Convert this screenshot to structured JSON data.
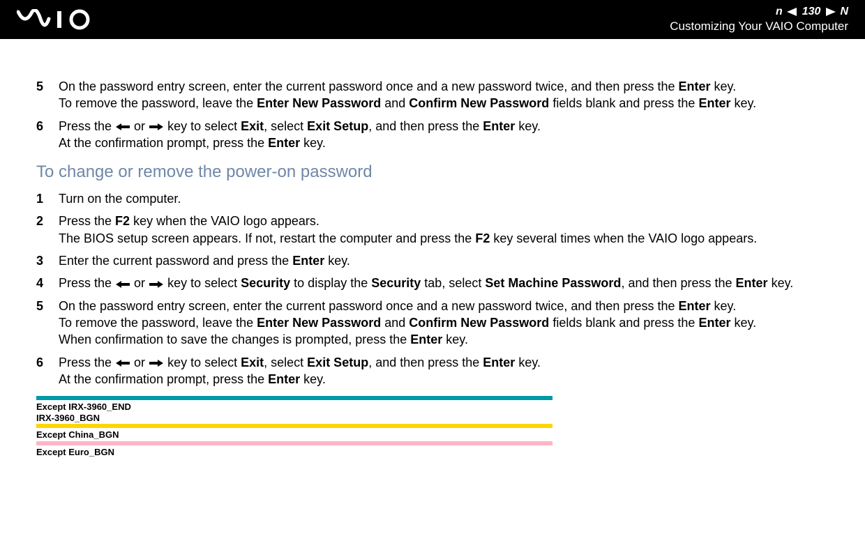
{
  "header": {
    "logo": "VAIO",
    "page_num": "130",
    "nav_label": "n N",
    "section": "Customizing Your VAIO Computer"
  },
  "step5a": {
    "num": "5",
    "p1a": "On the password entry screen, enter the current password once and a new password twice, and then press the ",
    "p1b": "Enter",
    "p1c": " key.",
    "p2a": "To remove the password, leave the ",
    "p2b": "Enter New Password",
    "p2c": " and ",
    "p2d": "Confirm New Password",
    "p2e": " fields blank and press the ",
    "p2f": "Enter",
    "p2g": " key."
  },
  "step6a": {
    "num": "6",
    "p1a": "Press the ",
    "p1b": " or ",
    "p1c": " key to select ",
    "p1d": "Exit",
    "p1e": ", select ",
    "p1f": "Exit Setup",
    "p1g": ", and then press the ",
    "p1h": "Enter",
    "p1i": " key.",
    "p2a": "At the confirmation prompt, press the ",
    "p2b": "Enter",
    "p2c": " key."
  },
  "heading": "To change or remove the power-on password",
  "step1": {
    "num": "1",
    "text": "Turn on the computer."
  },
  "step2": {
    "num": "2",
    "p1a": "Press the ",
    "p1b": "F2",
    "p1c": " key when the VAIO logo appears.",
    "p2a": "The BIOS setup screen appears. If not, restart the computer and press the ",
    "p2b": "F2",
    "p2c": " key several times when the VAIO logo appears."
  },
  "step3": {
    "num": "3",
    "p1a": "Enter the current password and press the ",
    "p1b": "Enter",
    "p1c": " key."
  },
  "step4": {
    "num": "4",
    "p1a": "Press the ",
    "p1b": " or ",
    "p1c": " key to select ",
    "p1d": "Security",
    "p1e": " to display the ",
    "p1f": "Security",
    "p1g": " tab, select ",
    "p1h": "Set Machine Password",
    "p1i": ", and then press the ",
    "p1j": "Enter",
    "p1k": " key."
  },
  "step5b": {
    "num": "5",
    "p1a": "On the password entry screen, enter the current password once and a new password twice, and then press the ",
    "p1b": "Enter",
    "p1c": " key.",
    "p2a": "To remove the password, leave the ",
    "p2b": "Enter New Password",
    "p2c": " and ",
    "p2d": "Confirm New Password",
    "p2e": " fields blank and press the ",
    "p2f": "Enter",
    "p2g": " key.",
    "p3a": "When confirmation to save the changes is prompted, press the ",
    "p3b": "Enter",
    "p3c": " key."
  },
  "step6b": {
    "num": "6",
    "p1a": "Press the ",
    "p1b": " or ",
    "p1c": " key to select ",
    "p1d": "Exit",
    "p1e": ", select ",
    "p1f": "Exit Setup",
    "p1g": ", and then press the ",
    "p1h": "Enter",
    "p1i": " key.",
    "p2a": "At the confirmation prompt, press the ",
    "p2b": "Enter",
    "p2c": " key."
  },
  "markers": {
    "m1l1": "Except IRX-3960_END",
    "m1l2": "IRX-3960_BGN",
    "m2": "Except China_BGN",
    "m3": "Except Euro_BGN"
  }
}
